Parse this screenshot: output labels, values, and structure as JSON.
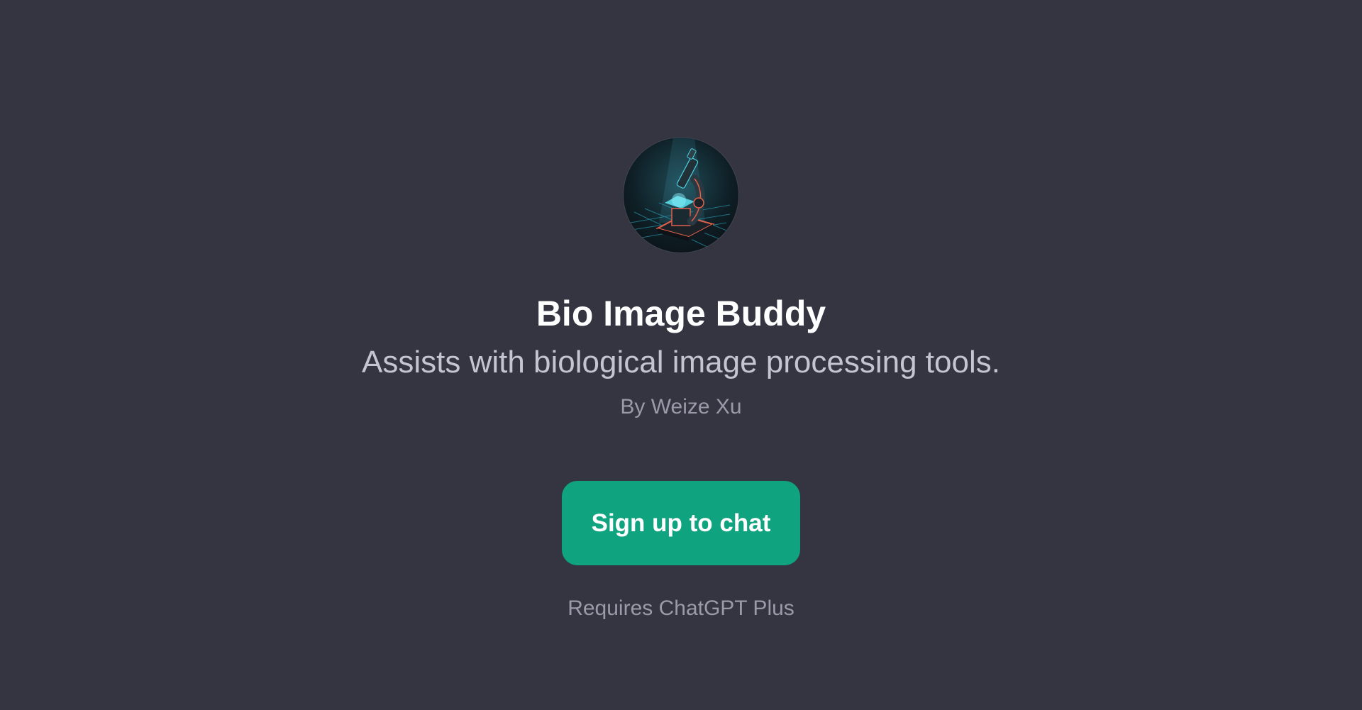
{
  "gpt": {
    "name": "Bio Image Buddy",
    "description": "Assists with biological image processing tools.",
    "author": "By Weize Xu",
    "avatar_icon": "microscope-icon"
  },
  "actions": {
    "signup_label": "Sign up to chat",
    "requirement_note": "Requires ChatGPT Plus"
  },
  "colors": {
    "background": "#343541",
    "accent": "#10a37f",
    "title": "#ffffff",
    "subtitle": "#c5c5d2",
    "muted": "#9a9aa8"
  }
}
